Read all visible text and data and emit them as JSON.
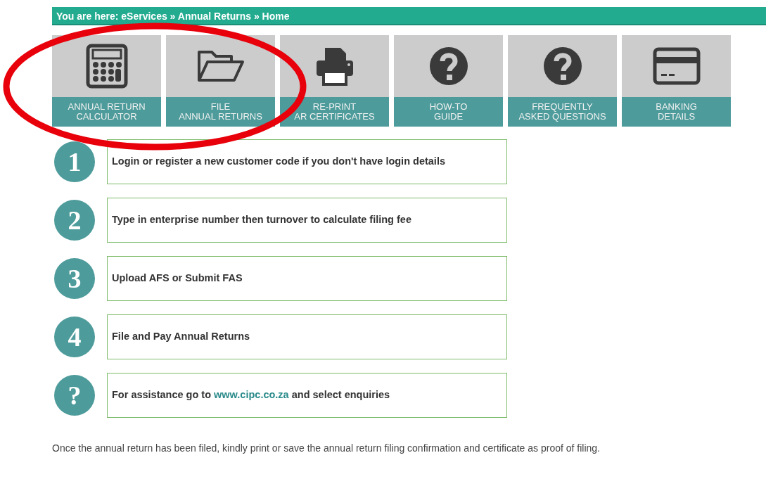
{
  "breadcrumb": "You are here: eServices » Annual Returns » Home",
  "tiles": [
    {
      "kind": "calculator",
      "lines": [
        "ANNUAL RETURN",
        "CALCULATOR"
      ]
    },
    {
      "kind": "folder",
      "lines": [
        "FILE",
        "ANNUAL RETURNS"
      ]
    },
    {
      "kind": "printer",
      "lines": [
        "RE-PRINT",
        "AR CERTIFICATES"
      ]
    },
    {
      "kind": "question",
      "lines": [
        "HOW-TO",
        "GUIDE"
      ]
    },
    {
      "kind": "question",
      "lines": [
        "FREQUENTLY",
        "ASKED QUESTIONS"
      ]
    },
    {
      "kind": "card",
      "lines": [
        "BANKING",
        "DETAILS"
      ]
    }
  ],
  "steps": [
    {
      "marker": "1",
      "text": "Login or register a new customer code if you don't have login details"
    },
    {
      "marker": "2",
      "text": "Type in enterprise number then turnover to calculate filing fee"
    },
    {
      "marker": "3",
      "text": "Upload AFS or Submit FAS"
    },
    {
      "marker": "4",
      "text": "File and Pay Annual Returns"
    },
    {
      "marker": "?",
      "text": "For assistance go to ",
      "link": "www.cipc.co.za",
      "text_after": " and select enquiries"
    }
  ],
  "note": "Once the annual return has been filed, kindly print or save the annual return filing confirmation and certificate as proof of filing.",
  "annotation": {
    "kind": "ellipse"
  }
}
